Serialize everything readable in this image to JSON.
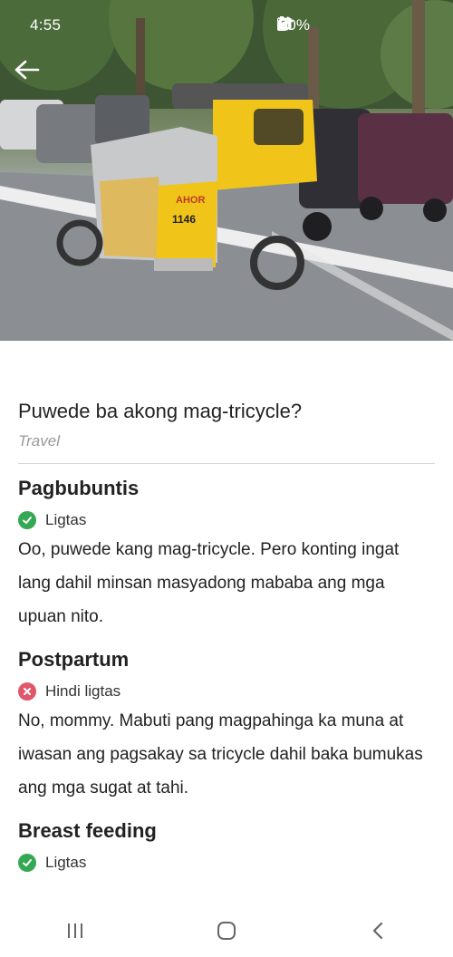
{
  "status_bar": {
    "time": "4:55",
    "battery": "60%",
    "icons": [
      "alarm-icon",
      "wifi-icon",
      "signal-icon",
      "battery-icon"
    ]
  },
  "header": {
    "back_icon": "arrow-left-icon"
  },
  "hero_image": {
    "description": "photo-tricycle"
  },
  "article": {
    "title": "Puwede ba akong mag-tricycle?",
    "category": "Travel"
  },
  "sections": [
    {
      "heading": "Pagbubuntis",
      "status": "Ligtas",
      "status_type": "safe",
      "body": "Oo, puwede kang mag-tricycle. Pero konting ingat lang dahil minsan masyadong mababa ang mga upuan nito."
    },
    {
      "heading": "Postpartum",
      "status": "Hindi ligtas",
      "status_type": "unsafe",
      "body": "No, mommy. Mabuti pang magpahinga ka muna at iwasan ang pagsakay sa tricycle dahil baka bumukas ang mga sugat at tahi."
    },
    {
      "heading": "Breast feeding",
      "status": "Ligtas",
      "status_type": "safe",
      "body": ""
    }
  ],
  "colors": {
    "safe": "#35a853",
    "unsafe": "#e0566b",
    "tricycle": "#f0c419"
  },
  "nav": {
    "icons": [
      "recent-apps-icon",
      "home-icon",
      "back-icon"
    ]
  }
}
